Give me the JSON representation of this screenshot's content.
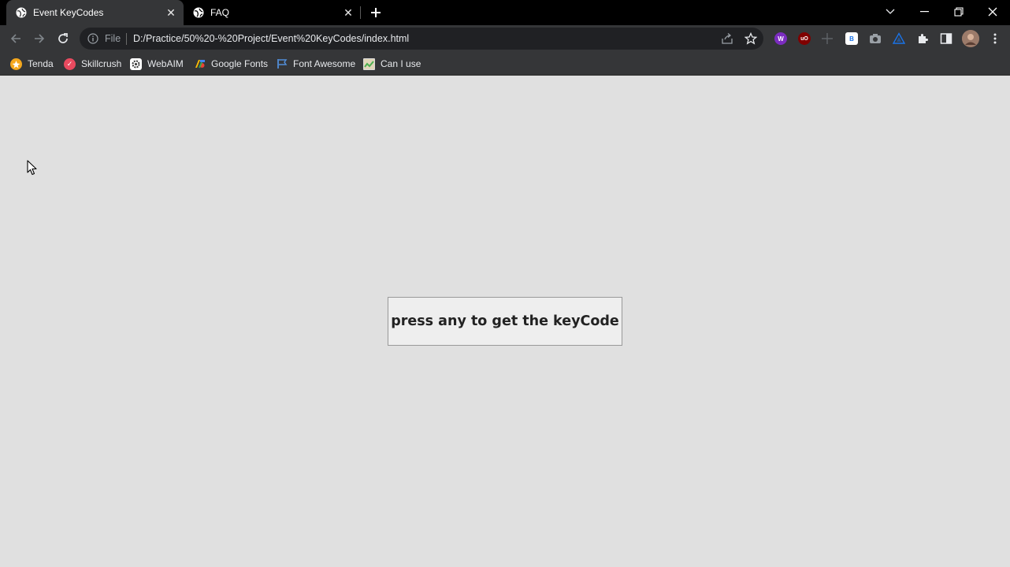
{
  "browser": {
    "tabs": [
      {
        "title": "Event KeyCodes",
        "active": true
      },
      {
        "title": "FAQ",
        "active": false
      }
    ],
    "address_bar": {
      "scheme_label": "File",
      "url": "D:/Practice/50%20-%20Project/Event%20KeyCodes/index.html"
    },
    "bookmarks": [
      {
        "label": "Tenda",
        "icon": "tenda-icon"
      },
      {
        "label": "Skillcrush",
        "icon": "skillcrush-icon"
      },
      {
        "label": "WebAIM",
        "icon": "webaim-icon"
      },
      {
        "label": "Google Fonts",
        "icon": "google-fonts-icon"
      },
      {
        "label": "Font Awesome",
        "icon": "font-awesome-icon"
      },
      {
        "label": "Can I use",
        "icon": "caniuse-icon"
      }
    ],
    "extensions": [
      {
        "name": "w-extension-icon",
        "glyph": "W",
        "color": "#7b2cbf"
      },
      {
        "name": "ublock-icon",
        "glyph": "uO",
        "color": "#800000"
      },
      {
        "name": "measure-extension-icon",
        "glyph": "",
        "color": "#5f6368"
      },
      {
        "name": "b-extension-icon",
        "glyph": "B",
        "color": "#ffffff"
      },
      {
        "name": "camera-extension-icon",
        "glyph": "",
        "color": "#9aa0a6"
      },
      {
        "name": "triangle-extension-icon",
        "glyph": "",
        "color": "#1a73e8"
      }
    ]
  },
  "page": {
    "message": "press any to get the keyCode"
  },
  "colors": {
    "page_bg": "#e0e0e0",
    "box_bg": "#eeeeee",
    "chrome_dark": "#353638"
  }
}
